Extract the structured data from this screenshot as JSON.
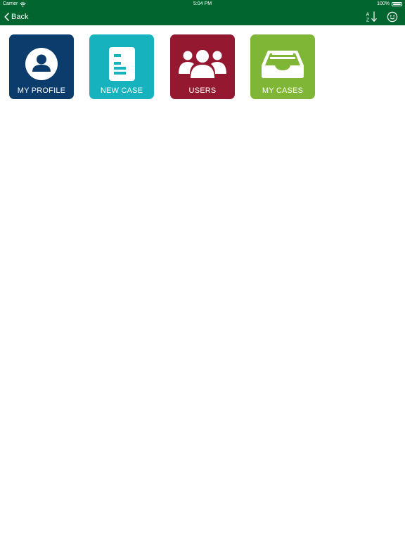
{
  "status_bar": {
    "carrier": "Carrier",
    "time": "5:04 PM",
    "battery": "100%"
  },
  "nav_bar": {
    "back_label": "Back",
    "sort_glyph_top": "A",
    "sort_glyph_bottom": "Z"
  },
  "tiles": [
    {
      "label": "MY PROFILE",
      "icon": "person-circle-icon",
      "color": "#0b3c6b"
    },
    {
      "label": "NEW CASE",
      "icon": "document-icon",
      "color": "#16b3bf"
    },
    {
      "label": "USERS",
      "icon": "users-group-icon",
      "color": "#941830"
    },
    {
      "label": "MY CASES",
      "icon": "inbox-tray-icon",
      "color": "#7fb636"
    }
  ],
  "colors": {
    "header": "#00652e",
    "background": "#ffffff"
  }
}
